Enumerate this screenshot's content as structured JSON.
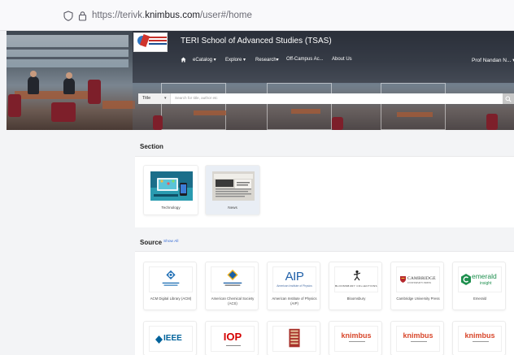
{
  "browser": {
    "url_prefix": "https://terivk.",
    "url_host": "knimbus.com",
    "url_suffix": "/user#/home"
  },
  "header": {
    "site_title": "TERI School of Advanced Studies (TSAS)",
    "nav": [
      "eCatalog ▾",
      "Explore ▾",
      "Research▾",
      "Off-Campus Ac...",
      "About Us"
    ],
    "profile": "Prof Nandan N... ▾"
  },
  "search": {
    "selector": "Title",
    "placeholder": "Search for title, author etc"
  },
  "section": {
    "title": "Section",
    "items": [
      {
        "label": "Technology"
      },
      {
        "label": "News"
      }
    ]
  },
  "source": {
    "title": "Source",
    "show_all": "Show All",
    "items": [
      {
        "label": "ACM Digital Library (ACM)"
      },
      {
        "label": "American Chemical Society (ACS)"
      },
      {
        "label": "American Institute of Physics (AIP)"
      },
      {
        "label": "Bloomsbury"
      },
      {
        "label": "Cambridge University Press"
      },
      {
        "label": "Emerald"
      }
    ],
    "logos": {
      "aip": "AIP",
      "aip_sub": "American Institute of Physics",
      "bloomsbury": "BLOOMSBURY COLLECTIONS",
      "cambridge": "CAMBRIDGE",
      "cambridge_sub": "UNIVERSITY PRESS",
      "emerald": "emerald",
      "emerald_sub": "insight",
      "ieee": "IEEE",
      "iop": "IOP",
      "knimbus": "knimbus"
    }
  },
  "colors": {
    "accent": "#3b6fd6",
    "brand_red": "#d0342c",
    "emerald_green": "#1e8f4e",
    "ieee_blue": "#00629b",
    "iop_red": "#d50000"
  }
}
